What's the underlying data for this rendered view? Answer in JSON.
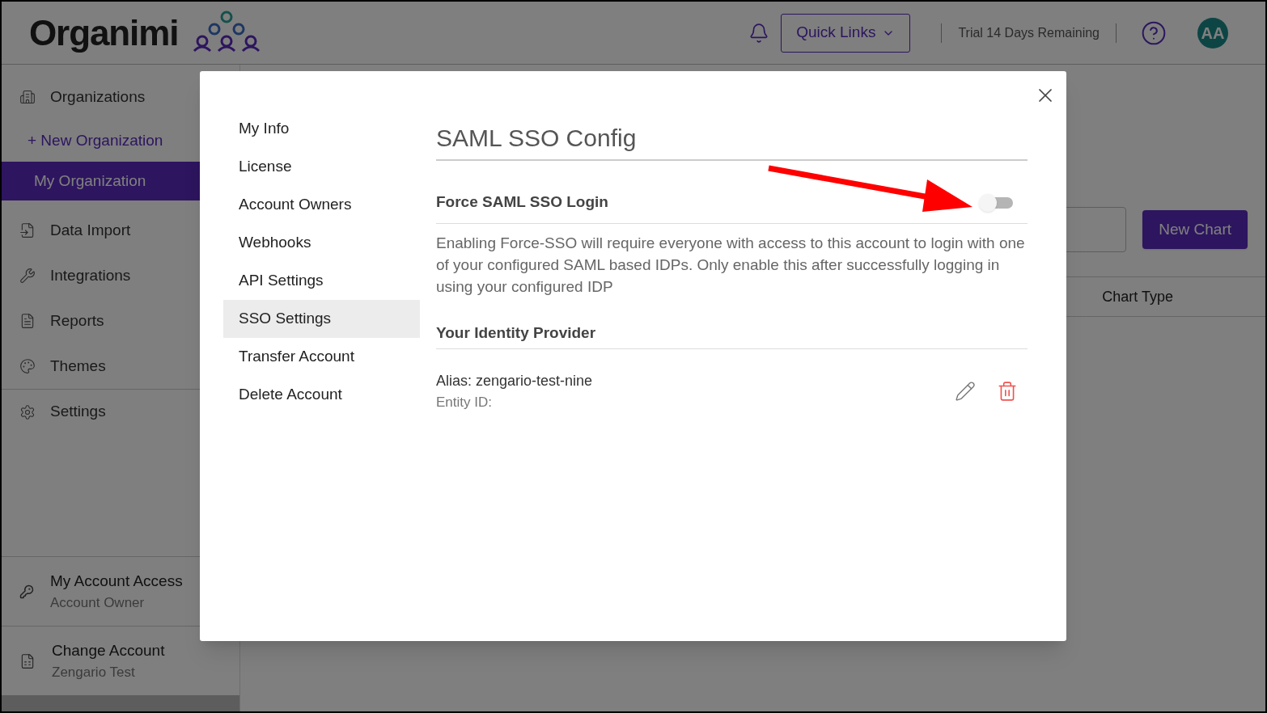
{
  "header": {
    "logo": "Organimi",
    "quick_links": "Quick Links",
    "trial": "Trial 14 Days Remaining",
    "avatar": "AA"
  },
  "sidebar": {
    "items": [
      {
        "label": "Organizations",
        "kind": "nav",
        "selected": false
      },
      {
        "label": "+ New Organization",
        "kind": "link",
        "selected": false
      },
      {
        "label": "My Organization",
        "kind": "sub",
        "selected": true
      },
      {
        "label": "Data Import",
        "kind": "nav",
        "selected": false
      },
      {
        "label": "Integrations",
        "kind": "nav",
        "selected": false
      },
      {
        "label": "Reports",
        "kind": "nav",
        "selected": false
      },
      {
        "label": "Themes",
        "kind": "nav",
        "selected": false
      },
      {
        "label": "Settings",
        "kind": "nav",
        "selected": false
      }
    ],
    "footer": [
      {
        "title": "My Account Access",
        "subtitle": "Account Owner"
      },
      {
        "title": "Change Account",
        "subtitle": "Zengario Test"
      }
    ]
  },
  "main": {
    "new_chart": "New Chart",
    "columns": [
      "Chart Type"
    ]
  },
  "dialog": {
    "nav": [
      {
        "label": "My Info",
        "selected": false
      },
      {
        "label": "License",
        "selected": false
      },
      {
        "label": "Account Owners",
        "selected": false
      },
      {
        "label": "Webhooks",
        "selected": false
      },
      {
        "label": "API Settings",
        "selected": false
      },
      {
        "label": "SSO Settings",
        "selected": true
      },
      {
        "label": "Transfer Account",
        "selected": false
      },
      {
        "label": "Delete Account",
        "selected": false
      }
    ],
    "title": "SAML SSO Config",
    "force_sso": {
      "label": "Force SAML SSO Login",
      "on": false
    },
    "description": "Enabling Force-SSO will require everyone with access to this account to login with one of your configured SAML based IDPs. Only enable this after successfully logging in using your configured IDP",
    "idp_heading": "Your Identity Provider",
    "idp": {
      "alias": "Alias: zengario-test-nine",
      "entity": "Entity ID:"
    }
  }
}
